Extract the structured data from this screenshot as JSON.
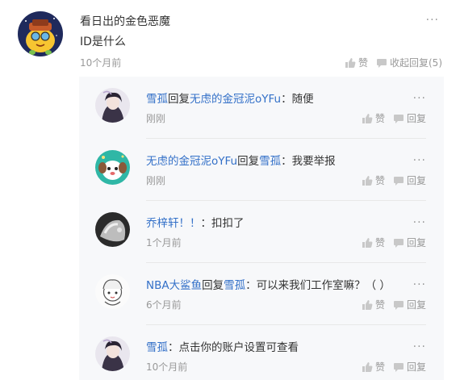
{
  "comment": {
    "author": "看日出的金色恶魔",
    "text": "ID是什么",
    "time": "10个月前",
    "like_label": "赞",
    "collapse_label": "收起回复(5)",
    "more": "···"
  },
  "replies": [
    {
      "user": "雪孤",
      "reply_word": "回复",
      "target": "无虑的金冠泥oYFu",
      "text": "：随便",
      "time": "刚刚",
      "like_label": "赞",
      "reply_label": "回复",
      "more": "···"
    },
    {
      "user": "无虑的金冠泥oYFu",
      "reply_word": "回复",
      "target": "雪孤",
      "text": "：我要举报",
      "time": "刚刚",
      "like_label": "赞",
      "reply_label": "回复",
      "more": "···"
    },
    {
      "user": "乔梓轩！！",
      "reply_word": "",
      "target": "",
      "text": "：扣扣了",
      "time": "1个月前",
      "like_label": "赞",
      "reply_label": "回复",
      "more": "···"
    },
    {
      "user": "NBA大鲨鱼",
      "reply_word": "回复",
      "target": "雪孤",
      "text": "：可以来我们工作室嘛？（ ）",
      "time": "6个月前",
      "like_label": "赞",
      "reply_label": "回复",
      "more": "···"
    },
    {
      "user": "雪孤",
      "reply_word": "",
      "target": "",
      "text": "：点击你的账户设置可查看",
      "time": "10个月前",
      "like_label": "赞",
      "reply_label": "回复",
      "more": "···"
    }
  ],
  "colors": {
    "link_blue": "#3370c8",
    "meta_gray": "#999999",
    "reply_bg": "#f7f8fa"
  }
}
